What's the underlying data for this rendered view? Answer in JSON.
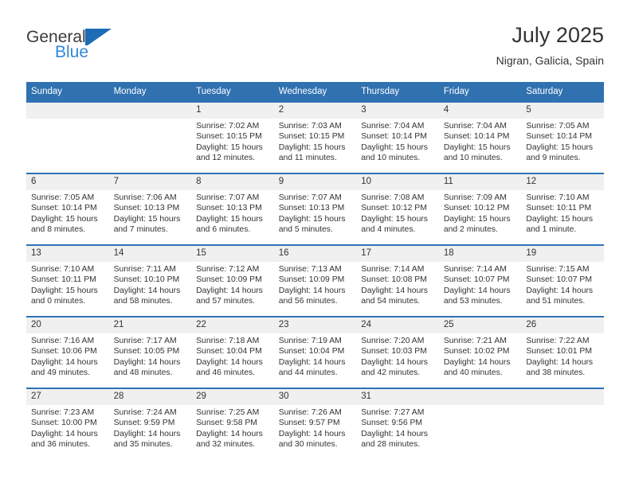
{
  "brand": {
    "name_top": "General",
    "name_bottom": "Blue",
    "flag_color": "#1d6cb5",
    "blue_text_color": "#2f86d6"
  },
  "header": {
    "title": "July 2025",
    "subtitle": "Nigran, Galicia, Spain"
  },
  "theme": {
    "header_blue": "#3071b0",
    "row_rule_blue": "#2f72b5",
    "daynum_band": "#f0f0f0"
  },
  "weekdays": [
    "Sunday",
    "Monday",
    "Tuesday",
    "Wednesday",
    "Thursday",
    "Friday",
    "Saturday"
  ],
  "weeks": [
    [
      {
        "day": "",
        "sunrise": "",
        "sunset": "",
        "daylight1": "",
        "daylight2": ""
      },
      {
        "day": "",
        "sunrise": "",
        "sunset": "",
        "daylight1": "",
        "daylight2": ""
      },
      {
        "day": "1",
        "sunrise": "Sunrise: 7:02 AM",
        "sunset": "Sunset: 10:15 PM",
        "daylight1": "Daylight: 15 hours",
        "daylight2": "and 12 minutes."
      },
      {
        "day": "2",
        "sunrise": "Sunrise: 7:03 AM",
        "sunset": "Sunset: 10:15 PM",
        "daylight1": "Daylight: 15 hours",
        "daylight2": "and 11 minutes."
      },
      {
        "day": "3",
        "sunrise": "Sunrise: 7:04 AM",
        "sunset": "Sunset: 10:14 PM",
        "daylight1": "Daylight: 15 hours",
        "daylight2": "and 10 minutes."
      },
      {
        "day": "4",
        "sunrise": "Sunrise: 7:04 AM",
        "sunset": "Sunset: 10:14 PM",
        "daylight1": "Daylight: 15 hours",
        "daylight2": "and 10 minutes."
      },
      {
        "day": "5",
        "sunrise": "Sunrise: 7:05 AM",
        "sunset": "Sunset: 10:14 PM",
        "daylight1": "Daylight: 15 hours",
        "daylight2": "and 9 minutes."
      }
    ],
    [
      {
        "day": "6",
        "sunrise": "Sunrise: 7:05 AM",
        "sunset": "Sunset: 10:14 PM",
        "daylight1": "Daylight: 15 hours",
        "daylight2": "and 8 minutes."
      },
      {
        "day": "7",
        "sunrise": "Sunrise: 7:06 AM",
        "sunset": "Sunset: 10:13 PM",
        "daylight1": "Daylight: 15 hours",
        "daylight2": "and 7 minutes."
      },
      {
        "day": "8",
        "sunrise": "Sunrise: 7:07 AM",
        "sunset": "Sunset: 10:13 PM",
        "daylight1": "Daylight: 15 hours",
        "daylight2": "and 6 minutes."
      },
      {
        "day": "9",
        "sunrise": "Sunrise: 7:07 AM",
        "sunset": "Sunset: 10:13 PM",
        "daylight1": "Daylight: 15 hours",
        "daylight2": "and 5 minutes."
      },
      {
        "day": "10",
        "sunrise": "Sunrise: 7:08 AM",
        "sunset": "Sunset: 10:12 PM",
        "daylight1": "Daylight: 15 hours",
        "daylight2": "and 4 minutes."
      },
      {
        "day": "11",
        "sunrise": "Sunrise: 7:09 AM",
        "sunset": "Sunset: 10:12 PM",
        "daylight1": "Daylight: 15 hours",
        "daylight2": "and 2 minutes."
      },
      {
        "day": "12",
        "sunrise": "Sunrise: 7:10 AM",
        "sunset": "Sunset: 10:11 PM",
        "daylight1": "Daylight: 15 hours",
        "daylight2": "and 1 minute."
      }
    ],
    [
      {
        "day": "13",
        "sunrise": "Sunrise: 7:10 AM",
        "sunset": "Sunset: 10:11 PM",
        "daylight1": "Daylight: 15 hours",
        "daylight2": "and 0 minutes."
      },
      {
        "day": "14",
        "sunrise": "Sunrise: 7:11 AM",
        "sunset": "Sunset: 10:10 PM",
        "daylight1": "Daylight: 14 hours",
        "daylight2": "and 58 minutes."
      },
      {
        "day": "15",
        "sunrise": "Sunrise: 7:12 AM",
        "sunset": "Sunset: 10:09 PM",
        "daylight1": "Daylight: 14 hours",
        "daylight2": "and 57 minutes."
      },
      {
        "day": "16",
        "sunrise": "Sunrise: 7:13 AM",
        "sunset": "Sunset: 10:09 PM",
        "daylight1": "Daylight: 14 hours",
        "daylight2": "and 56 minutes."
      },
      {
        "day": "17",
        "sunrise": "Sunrise: 7:14 AM",
        "sunset": "Sunset: 10:08 PM",
        "daylight1": "Daylight: 14 hours",
        "daylight2": "and 54 minutes."
      },
      {
        "day": "18",
        "sunrise": "Sunrise: 7:14 AM",
        "sunset": "Sunset: 10:07 PM",
        "daylight1": "Daylight: 14 hours",
        "daylight2": "and 53 minutes."
      },
      {
        "day": "19",
        "sunrise": "Sunrise: 7:15 AM",
        "sunset": "Sunset: 10:07 PM",
        "daylight1": "Daylight: 14 hours",
        "daylight2": "and 51 minutes."
      }
    ],
    [
      {
        "day": "20",
        "sunrise": "Sunrise: 7:16 AM",
        "sunset": "Sunset: 10:06 PM",
        "daylight1": "Daylight: 14 hours",
        "daylight2": "and 49 minutes."
      },
      {
        "day": "21",
        "sunrise": "Sunrise: 7:17 AM",
        "sunset": "Sunset: 10:05 PM",
        "daylight1": "Daylight: 14 hours",
        "daylight2": "and 48 minutes."
      },
      {
        "day": "22",
        "sunrise": "Sunrise: 7:18 AM",
        "sunset": "Sunset: 10:04 PM",
        "daylight1": "Daylight: 14 hours",
        "daylight2": "and 46 minutes."
      },
      {
        "day": "23",
        "sunrise": "Sunrise: 7:19 AM",
        "sunset": "Sunset: 10:04 PM",
        "daylight1": "Daylight: 14 hours",
        "daylight2": "and 44 minutes."
      },
      {
        "day": "24",
        "sunrise": "Sunrise: 7:20 AM",
        "sunset": "Sunset: 10:03 PM",
        "daylight1": "Daylight: 14 hours",
        "daylight2": "and 42 minutes."
      },
      {
        "day": "25",
        "sunrise": "Sunrise: 7:21 AM",
        "sunset": "Sunset: 10:02 PM",
        "daylight1": "Daylight: 14 hours",
        "daylight2": "and 40 minutes."
      },
      {
        "day": "26",
        "sunrise": "Sunrise: 7:22 AM",
        "sunset": "Sunset: 10:01 PM",
        "daylight1": "Daylight: 14 hours",
        "daylight2": "and 38 minutes."
      }
    ],
    [
      {
        "day": "27",
        "sunrise": "Sunrise: 7:23 AM",
        "sunset": "Sunset: 10:00 PM",
        "daylight1": "Daylight: 14 hours",
        "daylight2": "and 36 minutes."
      },
      {
        "day": "28",
        "sunrise": "Sunrise: 7:24 AM",
        "sunset": "Sunset: 9:59 PM",
        "daylight1": "Daylight: 14 hours",
        "daylight2": "and 35 minutes."
      },
      {
        "day": "29",
        "sunrise": "Sunrise: 7:25 AM",
        "sunset": "Sunset: 9:58 PM",
        "daylight1": "Daylight: 14 hours",
        "daylight2": "and 32 minutes."
      },
      {
        "day": "30",
        "sunrise": "Sunrise: 7:26 AM",
        "sunset": "Sunset: 9:57 PM",
        "daylight1": "Daylight: 14 hours",
        "daylight2": "and 30 minutes."
      },
      {
        "day": "31",
        "sunrise": "Sunrise: 7:27 AM",
        "sunset": "Sunset: 9:56 PM",
        "daylight1": "Daylight: 14 hours",
        "daylight2": "and 28 minutes."
      },
      {
        "day": "",
        "sunrise": "",
        "sunset": "",
        "daylight1": "",
        "daylight2": ""
      },
      {
        "day": "",
        "sunrise": "",
        "sunset": "",
        "daylight1": "",
        "daylight2": ""
      }
    ]
  ]
}
